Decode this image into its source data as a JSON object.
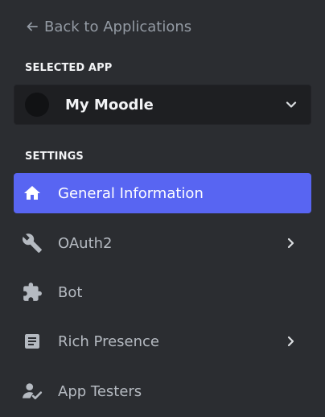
{
  "back_link": {
    "label": "Back to Applications",
    "icon": "arrow-left-icon"
  },
  "selected_app": {
    "section_label": "SELECTED APP",
    "name": "My Moodle",
    "avatar_color": "#111214",
    "icon": "chevron-down-icon"
  },
  "settings": {
    "section_label": "SETTINGS",
    "items": [
      {
        "label": "General Information",
        "icon": "home-icon",
        "active": true,
        "has_chevron": false
      },
      {
        "label": "OAuth2",
        "icon": "wrench-icon",
        "active": false,
        "has_chevron": true
      },
      {
        "label": "Bot",
        "icon": "puzzle-piece-icon",
        "active": false,
        "has_chevron": false
      },
      {
        "label": "Rich Presence",
        "icon": "document-icon",
        "active": false,
        "has_chevron": true
      },
      {
        "label": "App Testers",
        "icon": "user-check-icon",
        "active": false,
        "has_chevron": false
      }
    ]
  },
  "colors": {
    "background": "#2b2d31",
    "accent": "#5865f2",
    "muted_text": "#949ba4",
    "nav_text": "#b5bac1"
  }
}
